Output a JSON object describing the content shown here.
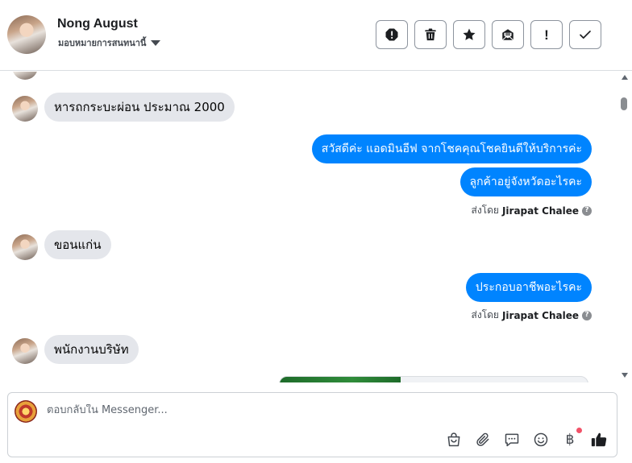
{
  "header": {
    "contact_name": "Nong August",
    "assign_label": "มอบหมายการสนทนานี้",
    "actions": [
      {
        "name": "spam-button",
        "icon": "alert-octagon-icon"
      },
      {
        "name": "delete-button",
        "icon": "trash-icon"
      },
      {
        "name": "follow-up-button",
        "icon": "star-icon"
      },
      {
        "name": "mark-unread-button",
        "icon": "envelope-icon"
      },
      {
        "name": "priority-button",
        "icon": "exclamation-icon",
        "label": "!"
      },
      {
        "name": "mark-done-button",
        "icon": "checkmark-icon"
      }
    ]
  },
  "messages": {
    "m1": "หารถกระบะผ่อน ประมาณ 2000",
    "m2": "สวัสดีค่ะ แอดมินอีฟ จากโชคคุณโชคยินดีให้บริการค่ะ",
    "m3": "ลูกค้าอยู่จังหวัดอะไรคะ",
    "sent_by_prefix": "ส่งโดย",
    "agent_name": "Jirapat Chalee",
    "m4": "ขอนแก่น",
    "m5": "ประกอบอาชีพอะไรคะ",
    "m6": "พนักงานบริษัท"
  },
  "composer": {
    "placeholder": "ตอบกลับใน Messenger...",
    "tools": [
      "shopping-bag-icon",
      "paperclip-icon",
      "saved-replies-icon",
      "emoji-icon",
      "baht-payment-icon",
      "thumbs-up-icon"
    ],
    "baht_symbol": "฿",
    "accent": "#f25268"
  },
  "colors": {
    "outgoing_bubble": "#0084ff",
    "incoming_bubble": "#e4e6eb",
    "like": "#1c1e21"
  }
}
